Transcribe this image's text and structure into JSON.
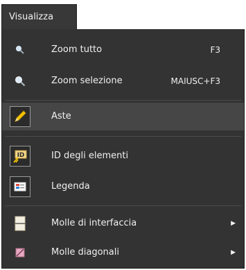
{
  "menu": {
    "title": "Visualizza"
  },
  "items": [
    {
      "label": "Zoom tutto",
      "shortcut": "F3",
      "icon": "zoom-all-icon"
    },
    {
      "label": "Zoom selezione",
      "shortcut": "MAIUSC+F3",
      "icon": "zoom-selection-icon"
    },
    {
      "label": "Aste",
      "icon": "pencil-icon"
    },
    {
      "label": "ID degli elementi",
      "icon": "element-id-icon"
    },
    {
      "label": "Legenda",
      "icon": "legend-icon"
    },
    {
      "label": "Molle di interfaccia",
      "icon": "interface-springs-icon"
    },
    {
      "label": "Molle diagonali",
      "icon": "diagonal-springs-icon"
    }
  ],
  "colors": {
    "menu_bg": "#333333",
    "highlight": "#464646",
    "text": "#f0f0f0"
  }
}
